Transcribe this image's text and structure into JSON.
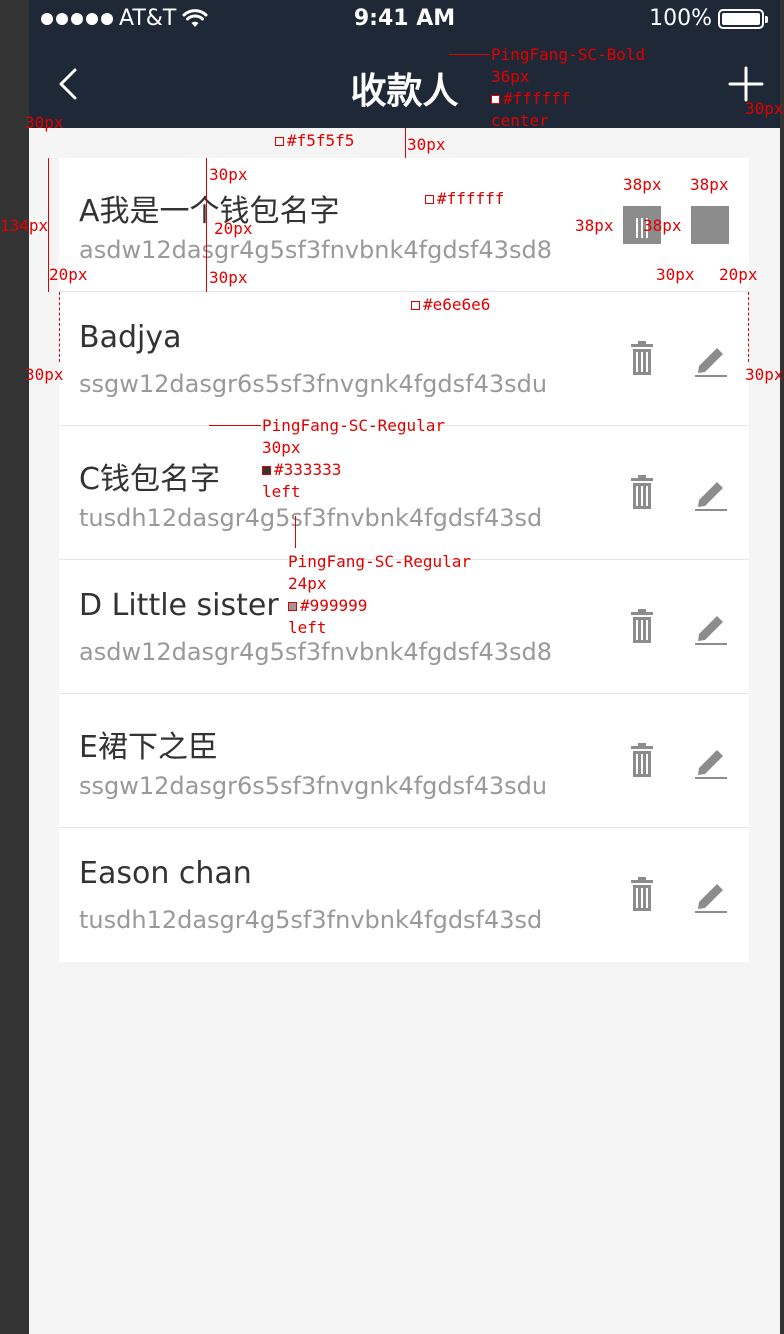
{
  "status_bar": {
    "carrier": "AT&T",
    "time": "9:41 AM",
    "battery": "100%"
  },
  "nav": {
    "title": "收款人",
    "back_icon": "chevron-left-icon",
    "add_icon": "plus-icon"
  },
  "wallets": [
    {
      "name": "A我是一个钱包名字",
      "account": "asdw12dasgr4g5sf3fnvbnk4fgdsf43sd8"
    },
    {
      "name": "Badjya",
      "account": "ssgw12dasgr6s5sf3fnvgnk4fgdsf43sdu"
    },
    {
      "name": "C钱包名字",
      "account": "tusdh12dasgr4g5sf3fnvbnk4fgdsf43sd"
    },
    {
      "name": "D Little sister",
      "account": "asdw12dasgr4g5sf3fnvbnk4fgdsf43sd8"
    },
    {
      "name": "E裙下之臣",
      "account": "ssgw12dasgr6s5sf3fnvgnk4fgdsf43sdu"
    },
    {
      "name": "Eason chan",
      "account": "tusdh12dasgr4g5sf3fnvbnk4fgdsf43sd"
    }
  ],
  "icons": {
    "delete": "trash-icon",
    "edit": "pencil-icon"
  },
  "colors": {
    "nav_bg": "#1e2836",
    "page_bg": "#f5f5f5",
    "card_bg": "#ffffff",
    "divider": "#e6e6e6",
    "name_text": "#333333",
    "account_text": "#999999",
    "icon": "#8c8c8c",
    "annotation": "#e00000"
  },
  "annotations": {
    "title_font": "PingFang-SC-Bold",
    "title_size": "36px",
    "title_color": "#ffffff",
    "title_align": "center",
    "page_bg": "#f5f5f5",
    "card_bg": "#ffffff",
    "divider": "#e6e6e6",
    "name_font": "PingFang-SC-Regular",
    "name_size": "30px",
    "name_color": "#333333",
    "name_align": "left",
    "acct_font": "PingFang-SC-Regular",
    "acct_size": "24px",
    "acct_color": "#999999",
    "acct_align": "left",
    "d30": "30px",
    "d20": "20px",
    "d38": "38px",
    "d134": "134px"
  }
}
